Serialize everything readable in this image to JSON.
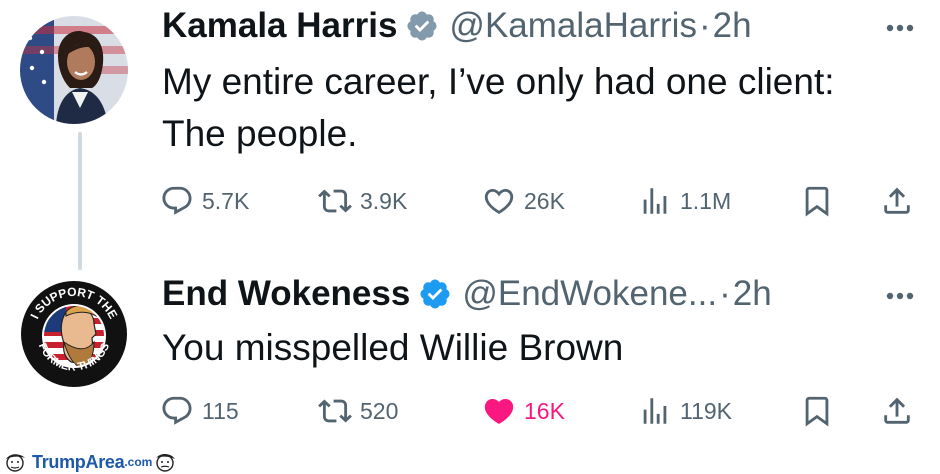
{
  "tweets": [
    {
      "display_name": "Kamala Harris",
      "handle": "@KamalaHarris",
      "separator": "·",
      "time": "2h",
      "text_lines": [
        "My entire career, I’ve only had one client:",
        "The people."
      ],
      "avatar_icon": "portrait-photo",
      "verified_color": "#829aab",
      "liked": false,
      "counts": {
        "replies": "5.7K",
        "retweets": "3.9K",
        "likes": "26K",
        "views": "1.1M"
      }
    },
    {
      "display_name": "End Wokeness",
      "handle": "@EndWokene...",
      "separator": "·",
      "time": "2h",
      "text_lines": [
        "You misspelled Willie Brown"
      ],
      "avatar_icon": "i-support-the-former-things-badge",
      "avatar_text_top": "I SUPPORT THE",
      "avatar_text_bottom": "FORMER THINGS",
      "verified_color": "#1d9bf0",
      "liked": true,
      "counts": {
        "replies": "115",
        "retweets": "520",
        "likes": "16K",
        "views": "119K"
      }
    }
  ],
  "colors": {
    "text": "#0f1419",
    "secondary": "#536471",
    "like_active": "#f91880",
    "thread_line": "#cfd9de"
  },
  "watermark": {
    "brand": "TrumpArea",
    "suffix": ".com"
  }
}
